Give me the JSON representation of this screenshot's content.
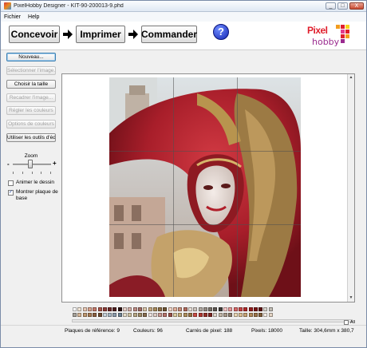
{
  "window": {
    "title": "PixelHobby Designer - KIT-90-200013-9.phd",
    "minimize": "_",
    "maximize": "□",
    "close": "X"
  },
  "menu": [
    "Fichier",
    "Help"
  ],
  "steps": [
    {
      "label": "Concevoir"
    },
    {
      "label": "Imprimer"
    },
    {
      "label": "Commander"
    }
  ],
  "help_label": "?",
  "logo": {
    "line1": "Pixel",
    "line2": "hobby"
  },
  "sidebar": {
    "buttons": [
      {
        "label": "Nouveau...",
        "enabled": true
      },
      {
        "label": "Sélectionner l'image...",
        "enabled": false
      },
      {
        "label": "Choisir la taille",
        "enabled": true
      },
      {
        "label": "Recadrer l'image...",
        "enabled": false
      },
      {
        "label": "Régler les couleurs",
        "enabled": false
      },
      {
        "label": "Options de couleurs",
        "enabled": false
      },
      {
        "label": "Utiliser les outils d'édition",
        "enabled": true
      }
    ],
    "zoom_label": "Zoom",
    "zoom_minus": "-",
    "zoom_plus": "+",
    "zoom_level": 0.45,
    "checkboxes": [
      {
        "label": "Animer le dessin",
        "checked": false
      },
      {
        "label": "Montrer plaque de base",
        "checked": true
      }
    ]
  },
  "palette": {
    "all_label": "All",
    "colors": [
      "#ffffff",
      "#f2e6d8",
      "#e8c8b4",
      "#d9a28c",
      "#c47a6a",
      "#a8554a",
      "#8c3c36",
      "#6e2a28",
      "#4e1e1e",
      "#2e1414",
      "#e8d0c8",
      "#d4b0a8",
      "#bc8c84",
      "#a06c64",
      "#d8c4a8",
      "#c4a880",
      "#a88a5c",
      "#8c6e44",
      "#6e5434",
      "#f4d6c8",
      "#e2b09a",
      "#c88e7a",
      "#b06a5c",
      "#e8e0d8",
      "#ccc4bc",
      "#b0a8a0",
      "#948c84",
      "#787068",
      "#5c5650",
      "#403c38",
      "#f8c8c8",
      "#e89898",
      "#d86868",
      "#c84444",
      "#b02828",
      "#941c1c",
      "#781414",
      "#5c1010",
      "#d8d4cc",
      "#c0bcb4",
      "#a8a49c",
      "#d8b898",
      "#c09870",
      "#a87c54",
      "#8c6040",
      "#704c30",
      "#c8d4dc",
      "#a8b8c4",
      "#8c9cac",
      "#708494",
      "#e4dcc8",
      "#d0c4a4",
      "#b8a884",
      "#a08c68",
      "#886e50",
      "#f0e4e0",
      "#e0ccc4",
      "#cc9c94",
      "#b8746c",
      "#985048",
      "#dccca0",
      "#c8b07c",
      "#b0905c",
      "#987444",
      "#cc4c44",
      "#b03830",
      "#983028",
      "#7c2420",
      "#e0d8cc",
      "#c4b8a8",
      "#a89888",
      "#8c7c6c",
      "#ecd8b4",
      "#dcc094",
      "#c8a474",
      "#b48c5c",
      "#9c7448",
      "#805c38",
      "#f4ece4",
      "#e4d4c4"
    ]
  },
  "status": {
    "plaques": "Plaques de référence:  9",
    "couleurs": "Couleurs:  96",
    "carres": "Carrés de pixel:  188",
    "pixels": "Pixels:  18000",
    "taille": "Taille:  304,6mm x 380,7"
  }
}
